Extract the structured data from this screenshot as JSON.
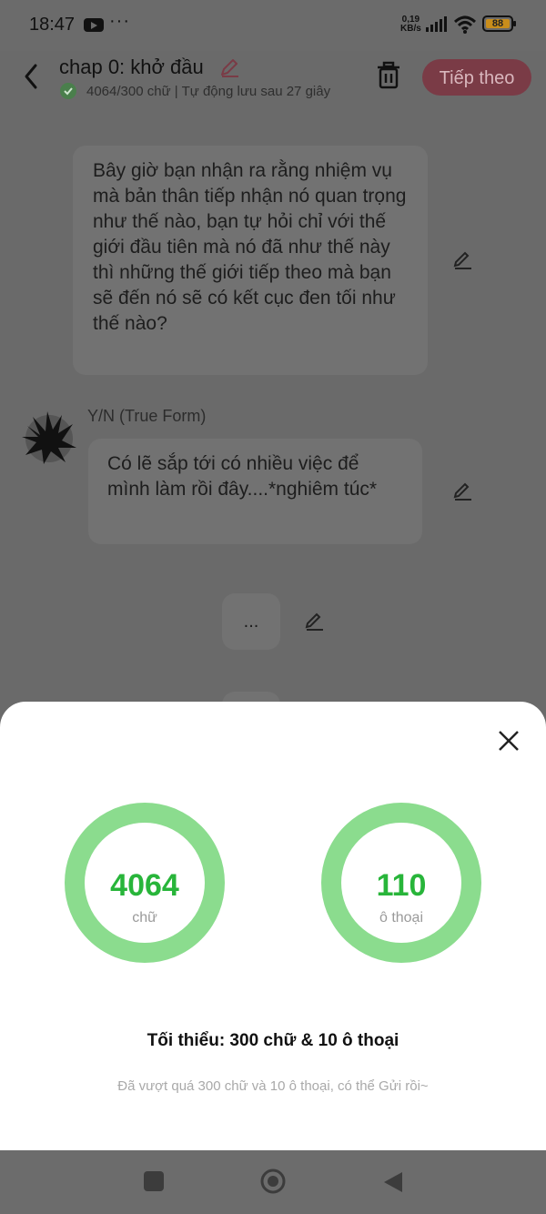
{
  "status": {
    "time": "18:47",
    "more": "···",
    "speed_value": "0,19",
    "speed_unit": "KB/s",
    "battery": "88"
  },
  "appbar": {
    "title": "chap 0: khở đầu",
    "subtitle": "4064/300 chữ | Tự động lưu sau 27 giây",
    "next_label": "Tiếp theo"
  },
  "messages": [
    {
      "text": "Bây giờ bạn nhận ra rằng nhiệm vụ mà bản thân tiếp nhận nó quan trọng như thế nào, bạn tự hỏi chỉ với thế giới đầu tiên mà nó đã như thế này thì những thế giới tiếp theo mà bạn sẽ đến nó sẽ có kết cục đen tối như thế nào?"
    },
    {
      "sender": "Y/N (True Form)",
      "text": "Có lẽ sắp tới có nhiều việc để mình làm rồi đây....*nghiêm túc*"
    },
    {
      "text": "..."
    }
  ],
  "sheet": {
    "words_count": "4064",
    "words_label": "chữ",
    "dialogs_count": "110",
    "dialogs_label": "ô thoại",
    "minimum": "Tối thiểu: 300 chữ & 10 ô thoại",
    "note": "Đã vượt quá 300 chữ và 10 ô thoại, có thể Gửi rồi~"
  },
  "colors": {
    "accent_red": "#e0264a",
    "ring_green": "#8bdc8e",
    "count_green": "#28b53a"
  },
  "icons": [
    "back-icon",
    "pencil-icon",
    "check-icon",
    "trash-icon",
    "edit-icon",
    "close-icon",
    "nav-square-icon",
    "nav-home-icon",
    "nav-back-icon"
  ]
}
